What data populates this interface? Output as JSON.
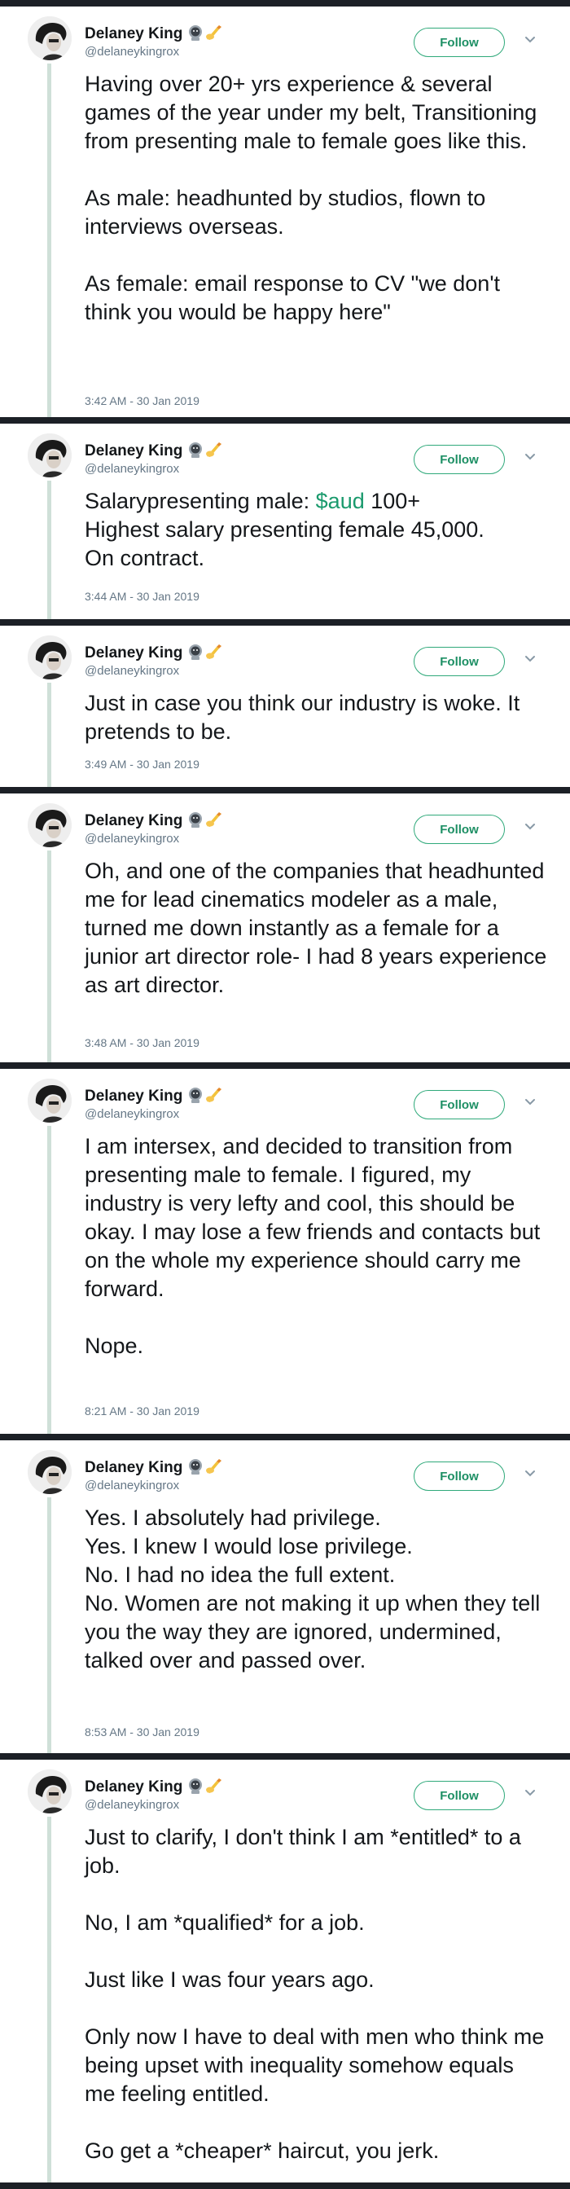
{
  "author": {
    "name": "Delaney King",
    "handle": "@delaneykingrox",
    "badge_icons": [
      "cat-astronaut-icon",
      "writing-hand-icon"
    ]
  },
  "follow_label": "Follow",
  "colors": {
    "accent": "#1d8f64",
    "separator": "#1c2026",
    "text": "#14171a",
    "muted": "#657786"
  },
  "tweets": [
    {
      "text": "Having over 20+ yrs experience & several games of the year under my belt, Transitioning from presenting male to female goes like this.\n\nAs male: headhunted by studios, flown to interviews overseas.\n\nAs female: email response to CV \"we don't think you would be happy here\"",
      "time": "3:42 AM - 30 Jan 2019"
    },
    {
      "text_before": "Salarypresenting male: ",
      "cashtag": "$aud",
      "text_after": " 100+\nHighest salary presenting female 45,000.\nOn contract.",
      "time": "3:44 AM - 30 Jan 2019"
    },
    {
      "text": "Just in case you think our industry is woke. It pretends to be.",
      "time": "3:49 AM - 30 Jan 2019"
    },
    {
      "text": "Oh, and one of the companies that headhunted me for lead cinematics modeler as a male, turned me down instantly as a female for a junior art director role- I had 8 years experience as art director.",
      "time": "3:48 AM - 30 Jan 2019"
    },
    {
      "text": "I am intersex, and decided to transition from presenting male to female.  I figured, my industry is very lefty and cool, this should be okay.  I may lose a few friends and contacts but on the whole my experience should carry me forward.\n\nNope.",
      "time": "8:21 AM - 30 Jan 2019"
    },
    {
      "text": "Yes. I absolutely had privilege.\nYes. I knew I would lose  privilege.\nNo. I had no idea the full extent.\nNo. Women are not making it up when they tell you the way they are ignored, undermined, talked over and passed over.",
      "time": "8:53 AM - 30 Jan 2019"
    },
    {
      "text": "Just to clarify, I don't think I am *entitled* to a job.\n\nNo, I am *qualified* for a job.\n\nJust like I was four years ago.\n\n Only now I have to deal with men who think me being upset with inequality somehow equals me feeling entitled.\n\nGo get a *cheaper* haircut, you jerk."
    }
  ]
}
